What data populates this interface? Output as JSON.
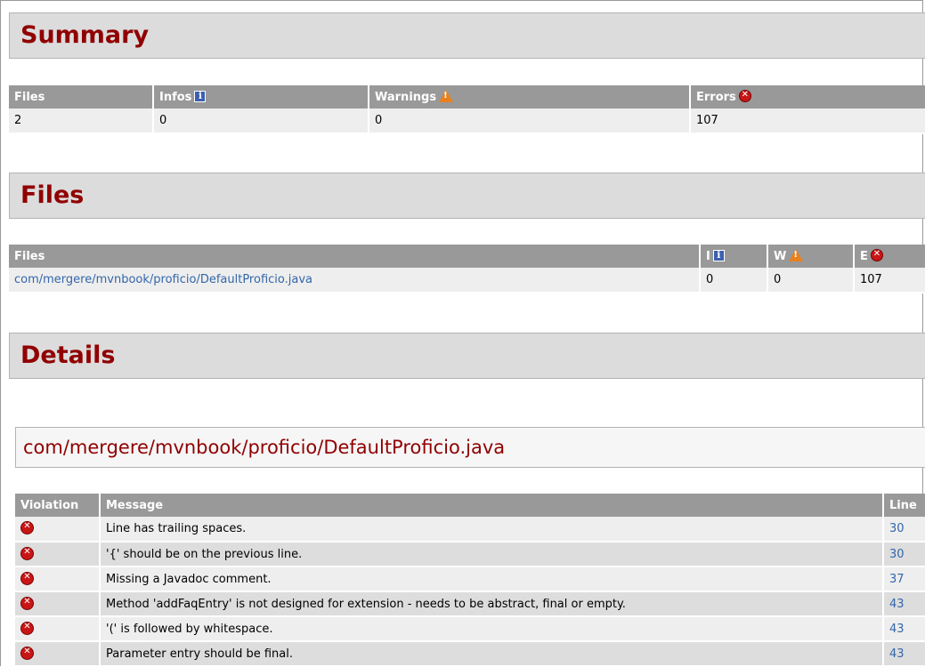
{
  "summary": {
    "title": "Summary",
    "headers": {
      "files": "Files",
      "infos": "Infos",
      "warnings": "Warnings",
      "errors": "Errors"
    },
    "values": {
      "files": "2",
      "infos": "0",
      "warnings": "0",
      "errors": "107"
    }
  },
  "files": {
    "title": "Files",
    "headers": {
      "files": "Files",
      "i": "I",
      "w": "W",
      "e": "E"
    },
    "rows": [
      {
        "name": "com/mergere/mvnbook/proficio/DefaultProficio.java",
        "i": "0",
        "w": "0",
        "e": "107"
      }
    ]
  },
  "details": {
    "title": "Details",
    "file_title": "com/mergere/mvnbook/proficio/DefaultProficio.java",
    "headers": {
      "violation": "Violation",
      "message": "Message",
      "line": "Line"
    },
    "rows": [
      {
        "icon": "error-icon",
        "message": "Line has trailing spaces.",
        "line": "30"
      },
      {
        "icon": "error-icon",
        "message": "'{' should be on the previous line.",
        "line": "30"
      },
      {
        "icon": "error-icon",
        "message": "Missing a Javadoc comment.",
        "line": "37"
      },
      {
        "icon": "error-icon",
        "message": "Method 'addFaqEntry' is not designed for extension - needs to be abstract, final or empty.",
        "line": "43"
      },
      {
        "icon": "error-icon",
        "message": "'(' is followed by whitespace.",
        "line": "43"
      },
      {
        "icon": "error-icon",
        "message": "Parameter entry should be final.",
        "line": "43"
      }
    ]
  },
  "colors": {
    "heading": "#900000",
    "header_bg": "#999999",
    "link": "#3366aa",
    "error": "#c81616",
    "warning": "#e8801c",
    "info": "#3c5fb0"
  }
}
